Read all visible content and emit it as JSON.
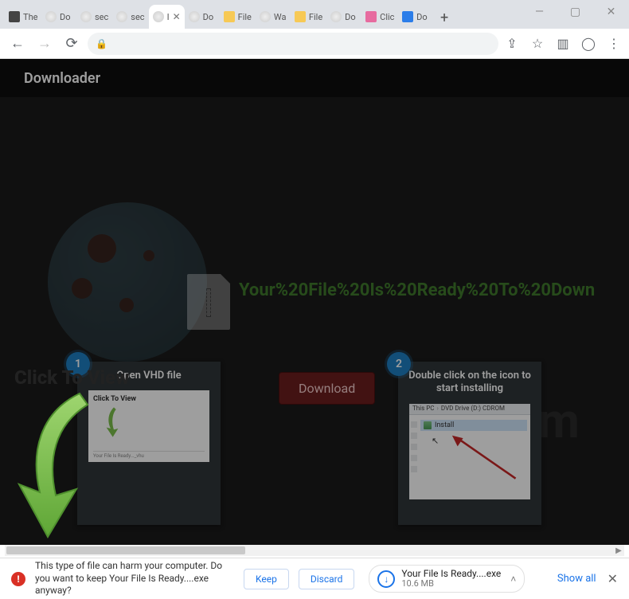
{
  "window": {
    "minimize": "—",
    "maximize": "▢",
    "close": "✕"
  },
  "tabs": [
    {
      "title": "The",
      "favicon": "fv-print"
    },
    {
      "title": "Do",
      "favicon": "fv-globe"
    },
    {
      "title": "sec",
      "favicon": "fv-globe"
    },
    {
      "title": "sec",
      "favicon": "fv-globe"
    },
    {
      "title": "I",
      "favicon": "fv-globe",
      "active": true
    },
    {
      "title": "Do",
      "favicon": "fv-globe"
    },
    {
      "title": "File",
      "favicon": "fv-lock"
    },
    {
      "title": "Wa",
      "favicon": "fv-globe"
    },
    {
      "title": "File",
      "favicon": "fv-lock"
    },
    {
      "title": "Do",
      "favicon": "fv-globe"
    },
    {
      "title": "Clic",
      "favicon": "fv-pink"
    },
    {
      "title": "Do",
      "favicon": "fv-dl"
    }
  ],
  "new_tab": "+",
  "nav": {
    "back": "←",
    "forward": "→",
    "reload": "⟳"
  },
  "omnibox": {
    "lock": "🔒"
  },
  "toolbar": {
    "share": "⇪",
    "star": "☆",
    "side": "▥",
    "profile": "◯",
    "menu": "⋮"
  },
  "page": {
    "app_title": "Downloader",
    "ready": "Your%20File%20Is%20Ready%20To%20Down",
    "download_btn": "Download",
    "step1": {
      "num": "1",
      "title": "Open VHD file",
      "preview_label": "Click To View",
      "footer": "Your File Is Ready..._vhu"
    },
    "step2": {
      "num": "2",
      "title": "Double click on the icon to start installing",
      "breadcrumb_root": "This PC",
      "breadcrumb_leaf": "DVD Drive (D:) CDROM",
      "install": "Install"
    },
    "overlay_ctv": "Click To View",
    "watermark": "sk.com"
  },
  "shelf": {
    "warn": "This type of file can harm your computer. Do you want to keep Your File Is Ready....exe anyway?",
    "keep": "Keep",
    "discard": "Discard",
    "file_name": "Your File Is Ready....exe",
    "file_size": "10.6 MB",
    "show_all": "Show all",
    "close": "✕",
    "chev": "˄",
    "dlglyph": "↓"
  }
}
